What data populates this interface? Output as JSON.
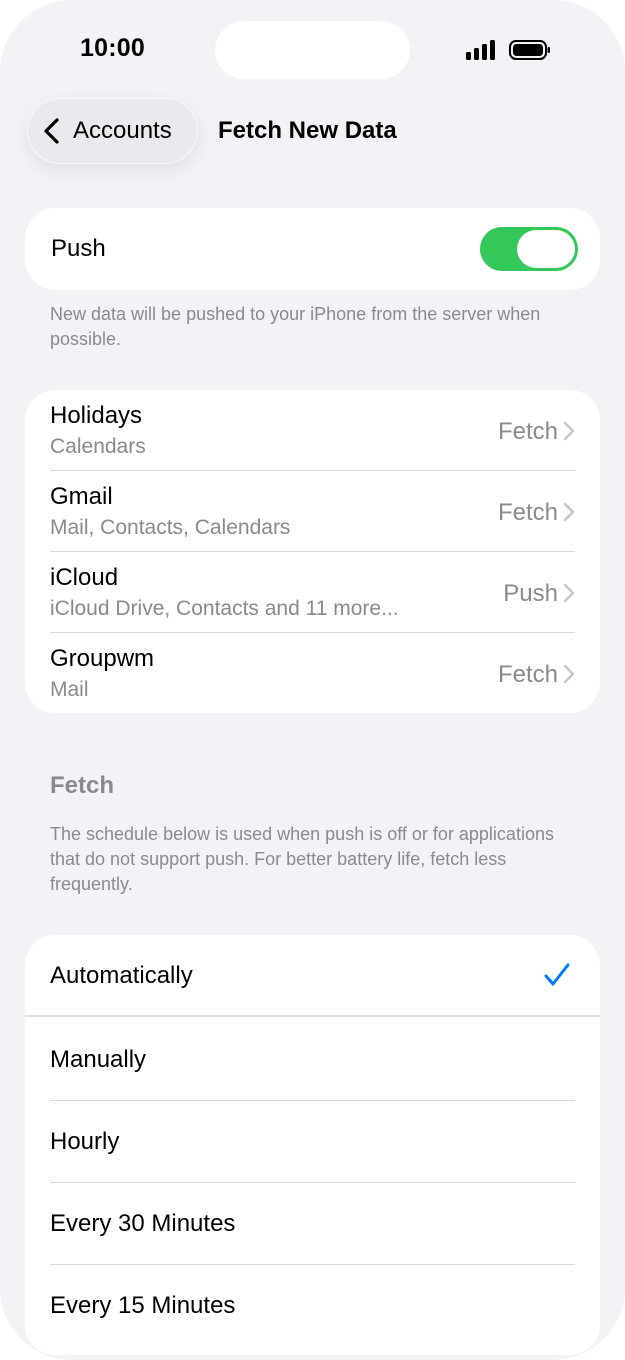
{
  "status_bar": {
    "time": "10:00"
  },
  "nav": {
    "back_label": "Accounts",
    "title": "Fetch New Data"
  },
  "push": {
    "label": "Push",
    "enabled": true,
    "footnote": "New data will be pushed to your iPhone from the server when possible."
  },
  "accounts": [
    {
      "name": "Holidays",
      "sub": "Calendars",
      "value": "Fetch"
    },
    {
      "name": "Gmail",
      "sub": "Mail, Contacts, Calendars",
      "value": "Fetch"
    },
    {
      "name": "iCloud",
      "sub": "iCloud Drive, Contacts and 11 more...",
      "value": "Push"
    },
    {
      "name": "Groupwm",
      "sub": "Mail",
      "value": "Fetch"
    }
  ],
  "fetch_section": {
    "header": "Fetch",
    "footnote": "The schedule below is used when push is off or for applications that do not support push. For better battery life, fetch less frequently.",
    "options": [
      {
        "label": "Automatically",
        "selected": true
      },
      {
        "label": "Manually",
        "selected": false
      },
      {
        "label": "Hourly",
        "selected": false
      },
      {
        "label": "Every 30 Minutes",
        "selected": false
      },
      {
        "label": "Every 15 Minutes",
        "selected": false
      }
    ]
  },
  "colors": {
    "accent": "#007aff",
    "toggle_on": "#34c759",
    "background": "#f2f2f7",
    "secondary_text": "#8a8a8e"
  },
  "icons": {
    "back": "chevron-left-icon",
    "disclosure": "chevron-right-icon",
    "selected": "checkmark-icon",
    "signal": "cellular-signal-icon",
    "battery": "battery-icon"
  }
}
